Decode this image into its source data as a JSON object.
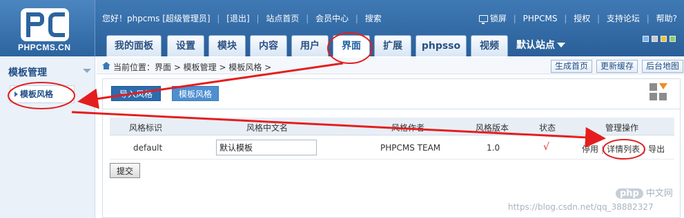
{
  "logo": {
    "text": "PHPCMS.CN"
  },
  "topnav": {
    "greeting": "您好！phpcms [超级管理员]",
    "logout": "[退出]",
    "site_home": "站点首页",
    "member_center": "会员中心",
    "search": "搜索"
  },
  "topright": {
    "lock": "锁屏",
    "brand": "PHPCMS",
    "license": "授权",
    "forum": "支持论坛",
    "help": "帮助?"
  },
  "skins": {
    "colors": [
      "#7fb2e6",
      "#c9c9c9",
      "#f1c232",
      "#8fce5c"
    ]
  },
  "tabs": [
    {
      "label": "我的面板"
    },
    {
      "label": "设置"
    },
    {
      "label": "模块"
    },
    {
      "label": "内容"
    },
    {
      "label": "用户"
    },
    {
      "label": "界面",
      "active": true
    },
    {
      "label": "扩展"
    },
    {
      "label": "phpsso"
    },
    {
      "label": "视频"
    }
  ],
  "site_dropdown": {
    "label": "默认站点"
  },
  "sidebar": {
    "title": "模板管理",
    "items": [
      {
        "label": "模板风格"
      }
    ]
  },
  "breadcrumb": {
    "text": "当前位置：界面 > 模板管理 > 模板风格 >"
  },
  "quick_buttons": {
    "generate_home": "生成首页",
    "refresh_cache": "更新缓存",
    "sitemap": "后台地图"
  },
  "subtabs": {
    "import": "导入风格",
    "styles": "模板风格"
  },
  "table": {
    "headers": [
      "风格标识",
      "风格中文名",
      "风格作者",
      "风格版本",
      "状态",
      "管理操作"
    ],
    "rows": [
      {
        "id": "default",
        "name": "默认模板",
        "author": "PHPCMS TEAM",
        "version": "1.0",
        "status": "√",
        "ops": {
          "disable": "停用",
          "details": "详情列表",
          "export": "导出"
        }
      }
    ]
  },
  "submit_label": "提交",
  "watermark": "https://blog.csdn.net/qq_38882327",
  "php_badge": {
    "bubble": "php",
    "text": "中文网"
  },
  "annotation_color": "#e41e1e"
}
